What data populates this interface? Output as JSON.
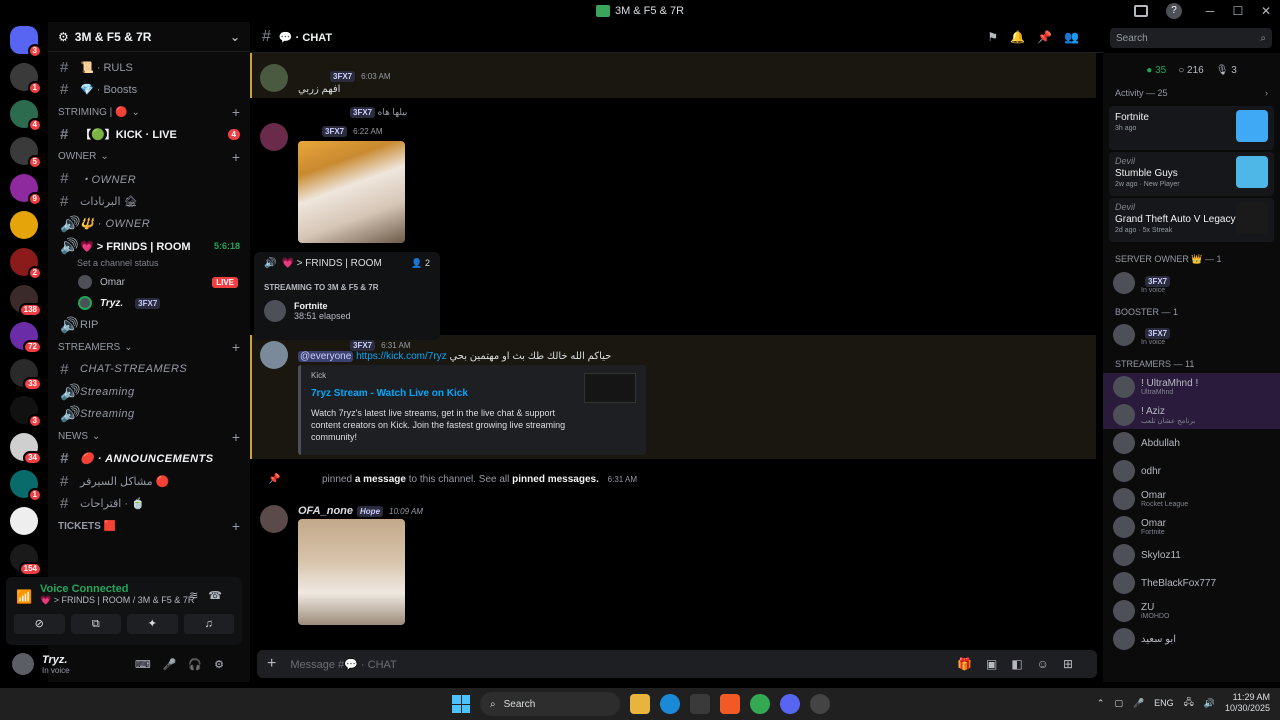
{
  "window": {
    "title": "3M & F5 & 7R"
  },
  "rail": {
    "servers": [
      {
        "name": "home",
        "badge": "3",
        "color": "#5865f2"
      },
      {
        "name": "server-1",
        "badge": "1",
        "color": "#3a3a3a"
      },
      {
        "name": "server-2",
        "badge": "4",
        "color": "#2d6b4f"
      },
      {
        "name": "server-3",
        "badge": "5",
        "color": "#3a3a3a"
      },
      {
        "name": "server-4",
        "badge": "9",
        "color": "#8e2a9e"
      },
      {
        "name": "server-5",
        "badge": "",
        "color": "#e5a50a"
      },
      {
        "name": "server-6",
        "badge": "2",
        "color": "#8b1a1a"
      },
      {
        "name": "server-7",
        "badge": "138",
        "color": "#3a2a2a"
      },
      {
        "name": "server-8",
        "badge": "72",
        "color": "#6b2ca8"
      },
      {
        "name": "server-9",
        "badge": "33",
        "color": "#2a2a2a"
      },
      {
        "name": "server-10",
        "badge": "3",
        "color": "#111"
      },
      {
        "name": "server-11",
        "badge": "34",
        "color": "#cfcfcf"
      },
      {
        "name": "server-12",
        "badge": "1",
        "color": "#0a6b6b"
      },
      {
        "name": "server-13",
        "badge": "",
        "color": "#eeeeee"
      },
      {
        "name": "server-14",
        "badge": "154",
        "color": "#1a1a1a"
      },
      {
        "name": "server-15",
        "badge": "",
        "color": "#3a3a5a"
      }
    ],
    "new_label": "NEW"
  },
  "sidebar": {
    "guild_name": "3M & F5 & 7R",
    "ch_ruls": "📜 · RULS",
    "ch_boosts": "💎 · Boosts",
    "cat_streaming": "STRIMING | 🔴",
    "ch_kick": "【🟢】KICK · LIVE",
    "ch_kick_badge": "4",
    "cat_owner": "owner",
    "ch_owner": "・OWNER",
    "ch_arabic1": "البرنادات 🏚",
    "vc_owner": "🔱 · OWNER",
    "vc_friends": "💗 > FRINDS | ROOM",
    "vc_friends_time": "5:6:18",
    "vc_friends_status": "Set a channel status",
    "vu_omar": "Omar",
    "vu_omar_live": "LIVE",
    "vu_tryz": "Tryz.",
    "vu_tryz_tag": "3FX7",
    "vc_rip": "RIP",
    "cat_streamers": "STREAMERS",
    "ch_chatstreamers": "CHAT-STREAMERS",
    "vc_streaming1": "Streaming",
    "vc_streaming2": "Streaming",
    "cat_news": "News",
    "ch_announcements": "🔴 · ANNOUNCEMENTS",
    "ch_arabic2": "مشاكل السيرفر 🔴",
    "ch_arabic3": "اقتراحات · 🍵",
    "cat_tickets": "TICKETS 🟥"
  },
  "voice": {
    "status": "Voice Connected",
    "room": "💗 > FRINDS | ROOM / 3M & F5 & 7R"
  },
  "user": {
    "name": "Tryz.",
    "status": "In voice"
  },
  "chat": {
    "channel": "💬 · CHAT",
    "m1_name": "3FX7",
    "m1_time": "6:03 AM",
    "m1_text": "افهم زربي",
    "m2_reply": "بيلها هاه",
    "m2_name": "3FX7",
    "m2_time": "6:22 AM",
    "m3_name": "3FX7",
    "m3_time": "6:31 AM",
    "m3_everyone": "@everyone",
    "m3_link": "https://kick.com/7ryz",
    "m3_text": "حياكم الله خالك طك بث او مهتمين بحي",
    "embed_provider": "Kick",
    "embed_title": "7ryz Stream - Watch Live on Kick",
    "embed_desc": "Watch 7ryz's latest live streams, get in the live chat & support content creators on Kick. Join the fastest growing live streaming community!",
    "sys_pre": "pinned",
    "sys_msg": "a message",
    "sys_mid": "to this channel. See all",
    "sys_pins": "pinned messages.",
    "sys_time": "6:31 AM",
    "m4_name": "OFA_none",
    "m4_tag": "Hope",
    "m4_time": "10:09 AM",
    "composer_placeholder": "Message #💬 · CHAT"
  },
  "popover": {
    "title": "💗 > FRINDS | ROOM",
    "count": "2",
    "label": "STREAMING TO 3M & F5 & 7R",
    "game": "Fortnite",
    "elapsed": "38:51 elapsed"
  },
  "search": {
    "placeholder": "Search"
  },
  "members": {
    "online": "35",
    "total": "216",
    "voice": "3",
    "activity_label": "Activity — 25",
    "activities": [
      {
        "name": "",
        "game": "Fortnite",
        "time": "3h ago",
        "color": "#3fa9f5"
      },
      {
        "name": "Devil",
        "game": "Stumble Guys",
        "time": "2w ago · New Player",
        "color": "#4fb6e8"
      },
      {
        "name": "Devil",
        "game": "Grand Theft Auto V Legacy",
        "time": "2d ago · 5x Streak",
        "color": "#1a1a1a"
      }
    ],
    "cat_owner": "Server Owner 👑 — 1",
    "owner_tag": "3FX7",
    "owner_status": "In voice",
    "cat_booster": "Booster — 1",
    "booster_tag": "3FX7",
    "booster_status": "In voice",
    "cat_streamers": "STREAMERS — 11",
    "list": [
      {
        "name": "! UltraMhnd !",
        "sub": "UltraMhnd"
      },
      {
        "name": "! Aziz",
        "sub": "برنامج عشان تلعب"
      },
      {
        "name": "Abdullah",
        "sub": ""
      },
      {
        "name": "odhr",
        "sub": ""
      },
      {
        "name": "Omar",
        "sub": "Rocket League"
      },
      {
        "name": "Omar",
        "sub": "Fortnite"
      },
      {
        "name": "Skyloz11",
        "sub": ""
      },
      {
        "name": "TheBlackFox777",
        "sub": ""
      },
      {
        "name": "ZU",
        "sub": "iMOHDO"
      },
      {
        "name": "ابو سعيد",
        "sub": ""
      }
    ]
  },
  "taskbar": {
    "search": "Search",
    "lang": "ENG",
    "time": "11:29 AM",
    "date": "10/30/2025"
  }
}
